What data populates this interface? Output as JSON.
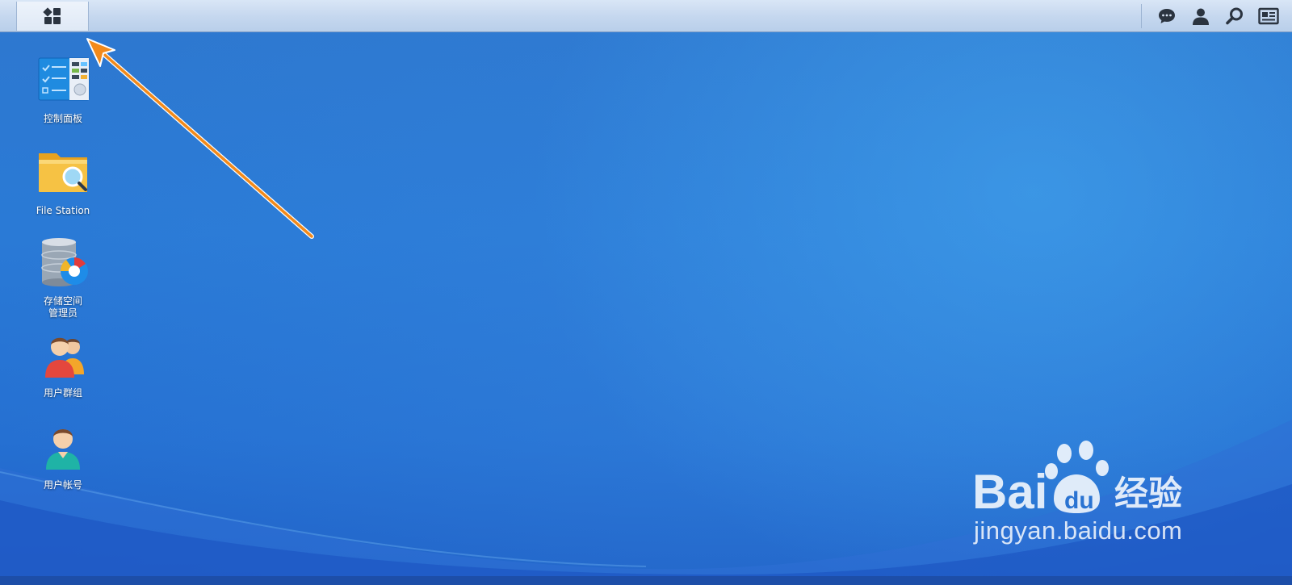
{
  "taskbar": {
    "main_menu_icon": "grid-apps-icon",
    "tray": [
      {
        "name": "notifications-icon"
      },
      {
        "name": "user-icon"
      },
      {
        "name": "search-icon"
      },
      {
        "name": "widgets-icon"
      }
    ]
  },
  "desktop": {
    "icons": [
      {
        "label": "控制面板",
        "icon": "control-panel-icon"
      },
      {
        "label": "File Station",
        "icon": "file-station-icon"
      },
      {
        "label": "存储空间\n管理员",
        "icon": "storage-manager-icon"
      },
      {
        "label": "用户群组",
        "icon": "user-group-icon"
      },
      {
        "label": "用户帐号",
        "icon": "user-account-icon"
      }
    ]
  },
  "watermark": {
    "brand": "Bai",
    "brand_suffix": "经验",
    "url": "jingyan.baidu.com"
  },
  "colors": {
    "desktop_blue": "#2a7ad6",
    "annotation_arrow": "#f28a1b",
    "taskbar": "#c6d8ef"
  }
}
